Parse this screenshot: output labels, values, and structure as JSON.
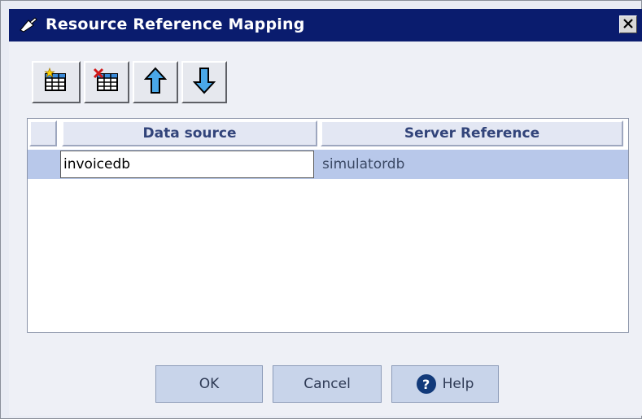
{
  "window": {
    "title": "Resource Reference Mapping",
    "close_icon": "close-icon",
    "app_icon": "mapping-icon"
  },
  "toolbar": {
    "buttons": [
      {
        "icon": "add-row-icon"
      },
      {
        "icon": "delete-row-icon"
      },
      {
        "icon": "move-up-icon"
      },
      {
        "icon": "move-down-icon"
      }
    ]
  },
  "table": {
    "columns": [
      "Data source",
      "Server Reference"
    ],
    "rows": [
      {
        "data_source": "invoicedb",
        "server_reference": "simulatordb"
      }
    ]
  },
  "buttons": {
    "ok": "OK",
    "cancel": "Cancel",
    "help": "Help",
    "help_glyph": "?"
  },
  "colors": {
    "titlebar": "#0a1c6e",
    "selected_row": "#b8c8ea",
    "header_text": "#32447a"
  }
}
